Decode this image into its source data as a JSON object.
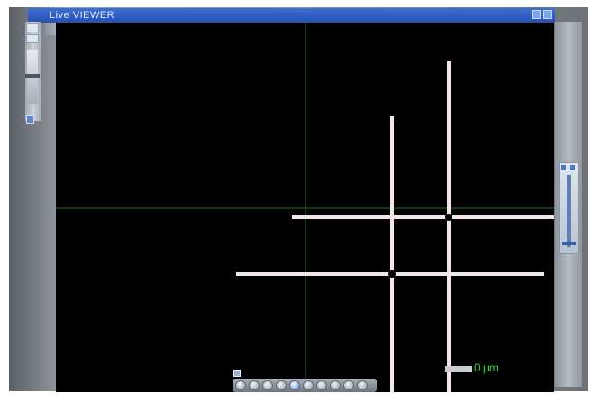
{
  "window": {
    "title": "Live VIEWER"
  },
  "scale_bar": {
    "label": "0 μm"
  },
  "colors": {
    "titlebar": "#2f5fc4",
    "viewer_background": "#000000",
    "crosshair": "#1f6b2a",
    "cross_pattern": "#f2e6e6",
    "scale_text": "#35d635"
  },
  "icons": {
    "window_buttons": [
      "minimize-icon",
      "maximize-icon",
      "close-icon"
    ],
    "navigation": [
      "first-icon",
      "prev-icon",
      "rewind-icon",
      "play-icon",
      "pause-icon",
      "stop-icon",
      "forward-icon",
      "next-icon",
      "last-icon",
      "record-icon"
    ]
  }
}
